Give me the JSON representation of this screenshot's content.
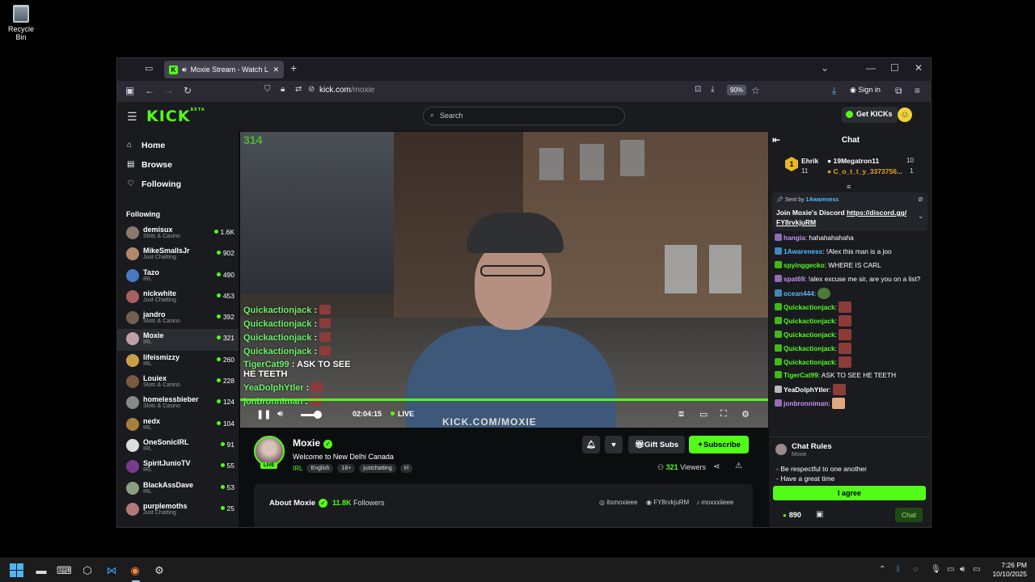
{
  "desktop": {
    "recycle_bin": "Recycle Bin"
  },
  "browser": {
    "tab_title": "Moxie Stream - Watch Live",
    "url_domain": "kick.com",
    "url_path": "/moxie",
    "zoom": "90%",
    "signin": "Sign in"
  },
  "header": {
    "logo": "KICK",
    "logo_beta": "BETA",
    "search_placeholder": "Search",
    "get_kicks": "Get KICKs"
  },
  "sidebar": {
    "nav": [
      "Home",
      "Browse",
      "Following"
    ],
    "following_heading": "Following",
    "channels": [
      {
        "name": "demisux",
        "category": "Slots & Casino",
        "viewers": "1.6K",
        "color": "#8a7a6a"
      },
      {
        "name": "MikeSmallsJr",
        "category": "Just Chatting",
        "viewers": "902",
        "color": "#b08a6a"
      },
      {
        "name": "Tazo",
        "category": "IRL",
        "viewers": "490",
        "color": "#4a78c0"
      },
      {
        "name": "nickwhite",
        "category": "Just Chatting",
        "viewers": "453",
        "color": "#a86060"
      },
      {
        "name": "jandro",
        "category": "Slots & Casino",
        "viewers": "392",
        "color": "#706050"
      },
      {
        "name": "Moxie",
        "category": "IRL",
        "viewers": "321",
        "color": "#c0a0a8"
      },
      {
        "name": "lifeismizzy",
        "category": "IRL",
        "viewers": "260",
        "color": "#c8a048"
      },
      {
        "name": "Louiex",
        "category": "Slots & Casino",
        "viewers": "228",
        "color": "#7a5a40"
      },
      {
        "name": "homelessbieber",
        "category": "Slots & Casino",
        "viewers": "124",
        "color": "#888888"
      },
      {
        "name": "nedx",
        "category": "IRL",
        "viewers": "104",
        "color": "#a8803a"
      },
      {
        "name": "OneSonicIRL",
        "category": "IRL",
        "viewers": "91",
        "color": "#dddddd"
      },
      {
        "name": "SpiritJunioTV",
        "category": "IRL",
        "viewers": "55",
        "color": "#7a3a8a"
      },
      {
        "name": "BlackAssDave",
        "category": "IRL",
        "viewers": "53",
        "color": "#8aa080"
      },
      {
        "name": "purplemoths",
        "category": "Just Chatting",
        "viewers": "25",
        "color": "#b07a7a"
      }
    ]
  },
  "player": {
    "overlay_count": "314",
    "overlay_chat": [
      {
        "user": "Quickactionjack",
        "text": ":"
      },
      {
        "user": "Quickactionjack",
        "text": ":"
      },
      {
        "user": "Quickactionjack",
        "text": ":"
      },
      {
        "user": "Quickactionjack",
        "text": ":"
      },
      {
        "user": "TigerCat99",
        "text": ": ASK TO SEE HE TEETH"
      },
      {
        "user": "YeaDolphYtler",
        "text": ":"
      },
      {
        "user": "jonbronniman",
        "text": ":"
      }
    ],
    "watermark": "KICK.COM/MOXIE",
    "elapsed": "02:04:15",
    "live_label": "LIVE",
    "progress": 1.0,
    "volume": 0.8
  },
  "stream": {
    "streamer": "Moxie",
    "live_badge": "LIVE",
    "title": "Welcome to New Delhi Canada",
    "category": "IRL",
    "tags": [
      "English",
      "18+",
      "justchatting",
      "irl"
    ],
    "gift_subs": "Gift Subs",
    "subscribe": "Subscribe",
    "viewers_count": "321",
    "viewers_label": "Viewers",
    "about_title": "About Moxie",
    "followers_count": "11.8K",
    "followers_label": "Followers",
    "socials": [
      "itsmoxieee",
      "FY8rvkjuRM",
      "moxxxiieee"
    ]
  },
  "chat": {
    "title": "Chat",
    "leaderboard": {
      "top_user": "Ehrik",
      "top_count": "11",
      "second_user": "19Megatron11",
      "second_count": "10",
      "third_user": "C_o_t_t_y_3373756...",
      "third_count": "1"
    },
    "pinned_by_prefix": "Sent by",
    "pinned_by_user": "1Awareness",
    "pinned_text": "Join Moxie's Discord",
    "pinned_link": "https://discord.gg/ FY8rvkjuRM",
    "messages": [
      {
        "user": "hangia",
        "color": "#c78ff0",
        "text": ": hahahahahaha"
      },
      {
        "user": "1Awareness",
        "color": "#53b8fc",
        "text": ": !Alex this man is a joo"
      },
      {
        "user": "spyinggecko",
        "color": "#53fc18",
        "text": ": WHERE IS CARL"
      },
      {
        "user": "spat69",
        "color": "#c78ff0",
        "text": ": !alex excuse me sir, are you on a list?"
      },
      {
        "user": "ocean444",
        "color": "#53b8fc",
        "text": ":"
      },
      {
        "user": "Quickactionjack",
        "color": "#53fc18",
        "text": ":"
      },
      {
        "user": "Quickactionjack",
        "color": "#53fc18",
        "text": ":"
      },
      {
        "user": "Quickactionjack",
        "color": "#53fc18",
        "text": ":"
      },
      {
        "user": "Quickactionjack",
        "color": "#53fc18",
        "text": ":"
      },
      {
        "user": "Quickactionjack",
        "color": "#53fc18",
        "text": ":"
      },
      {
        "user": "TigerCat99",
        "color": "#53fc18",
        "text": ": ASK TO SEE HE TEETH"
      },
      {
        "user": "YeaDolphYtler",
        "color": "#ffffff",
        "text": ":"
      },
      {
        "user": "jonbronniman",
        "color": "#c78ff0",
        "text": ":"
      }
    ],
    "rules_title": "Chat Rules",
    "rules_sub": "Moxie",
    "rules": [
      "- Be respectful to one another",
      "- Have a great time"
    ],
    "agree": "I agree",
    "points": "890",
    "send": "Chat"
  },
  "taskbar": {
    "time": "7:26 PM",
    "date": "10/10/2025"
  },
  "colors": {
    "kick_green": "#53fc18",
    "page_bg": "#0b0e0f",
    "panel_bg": "#191b1f"
  }
}
